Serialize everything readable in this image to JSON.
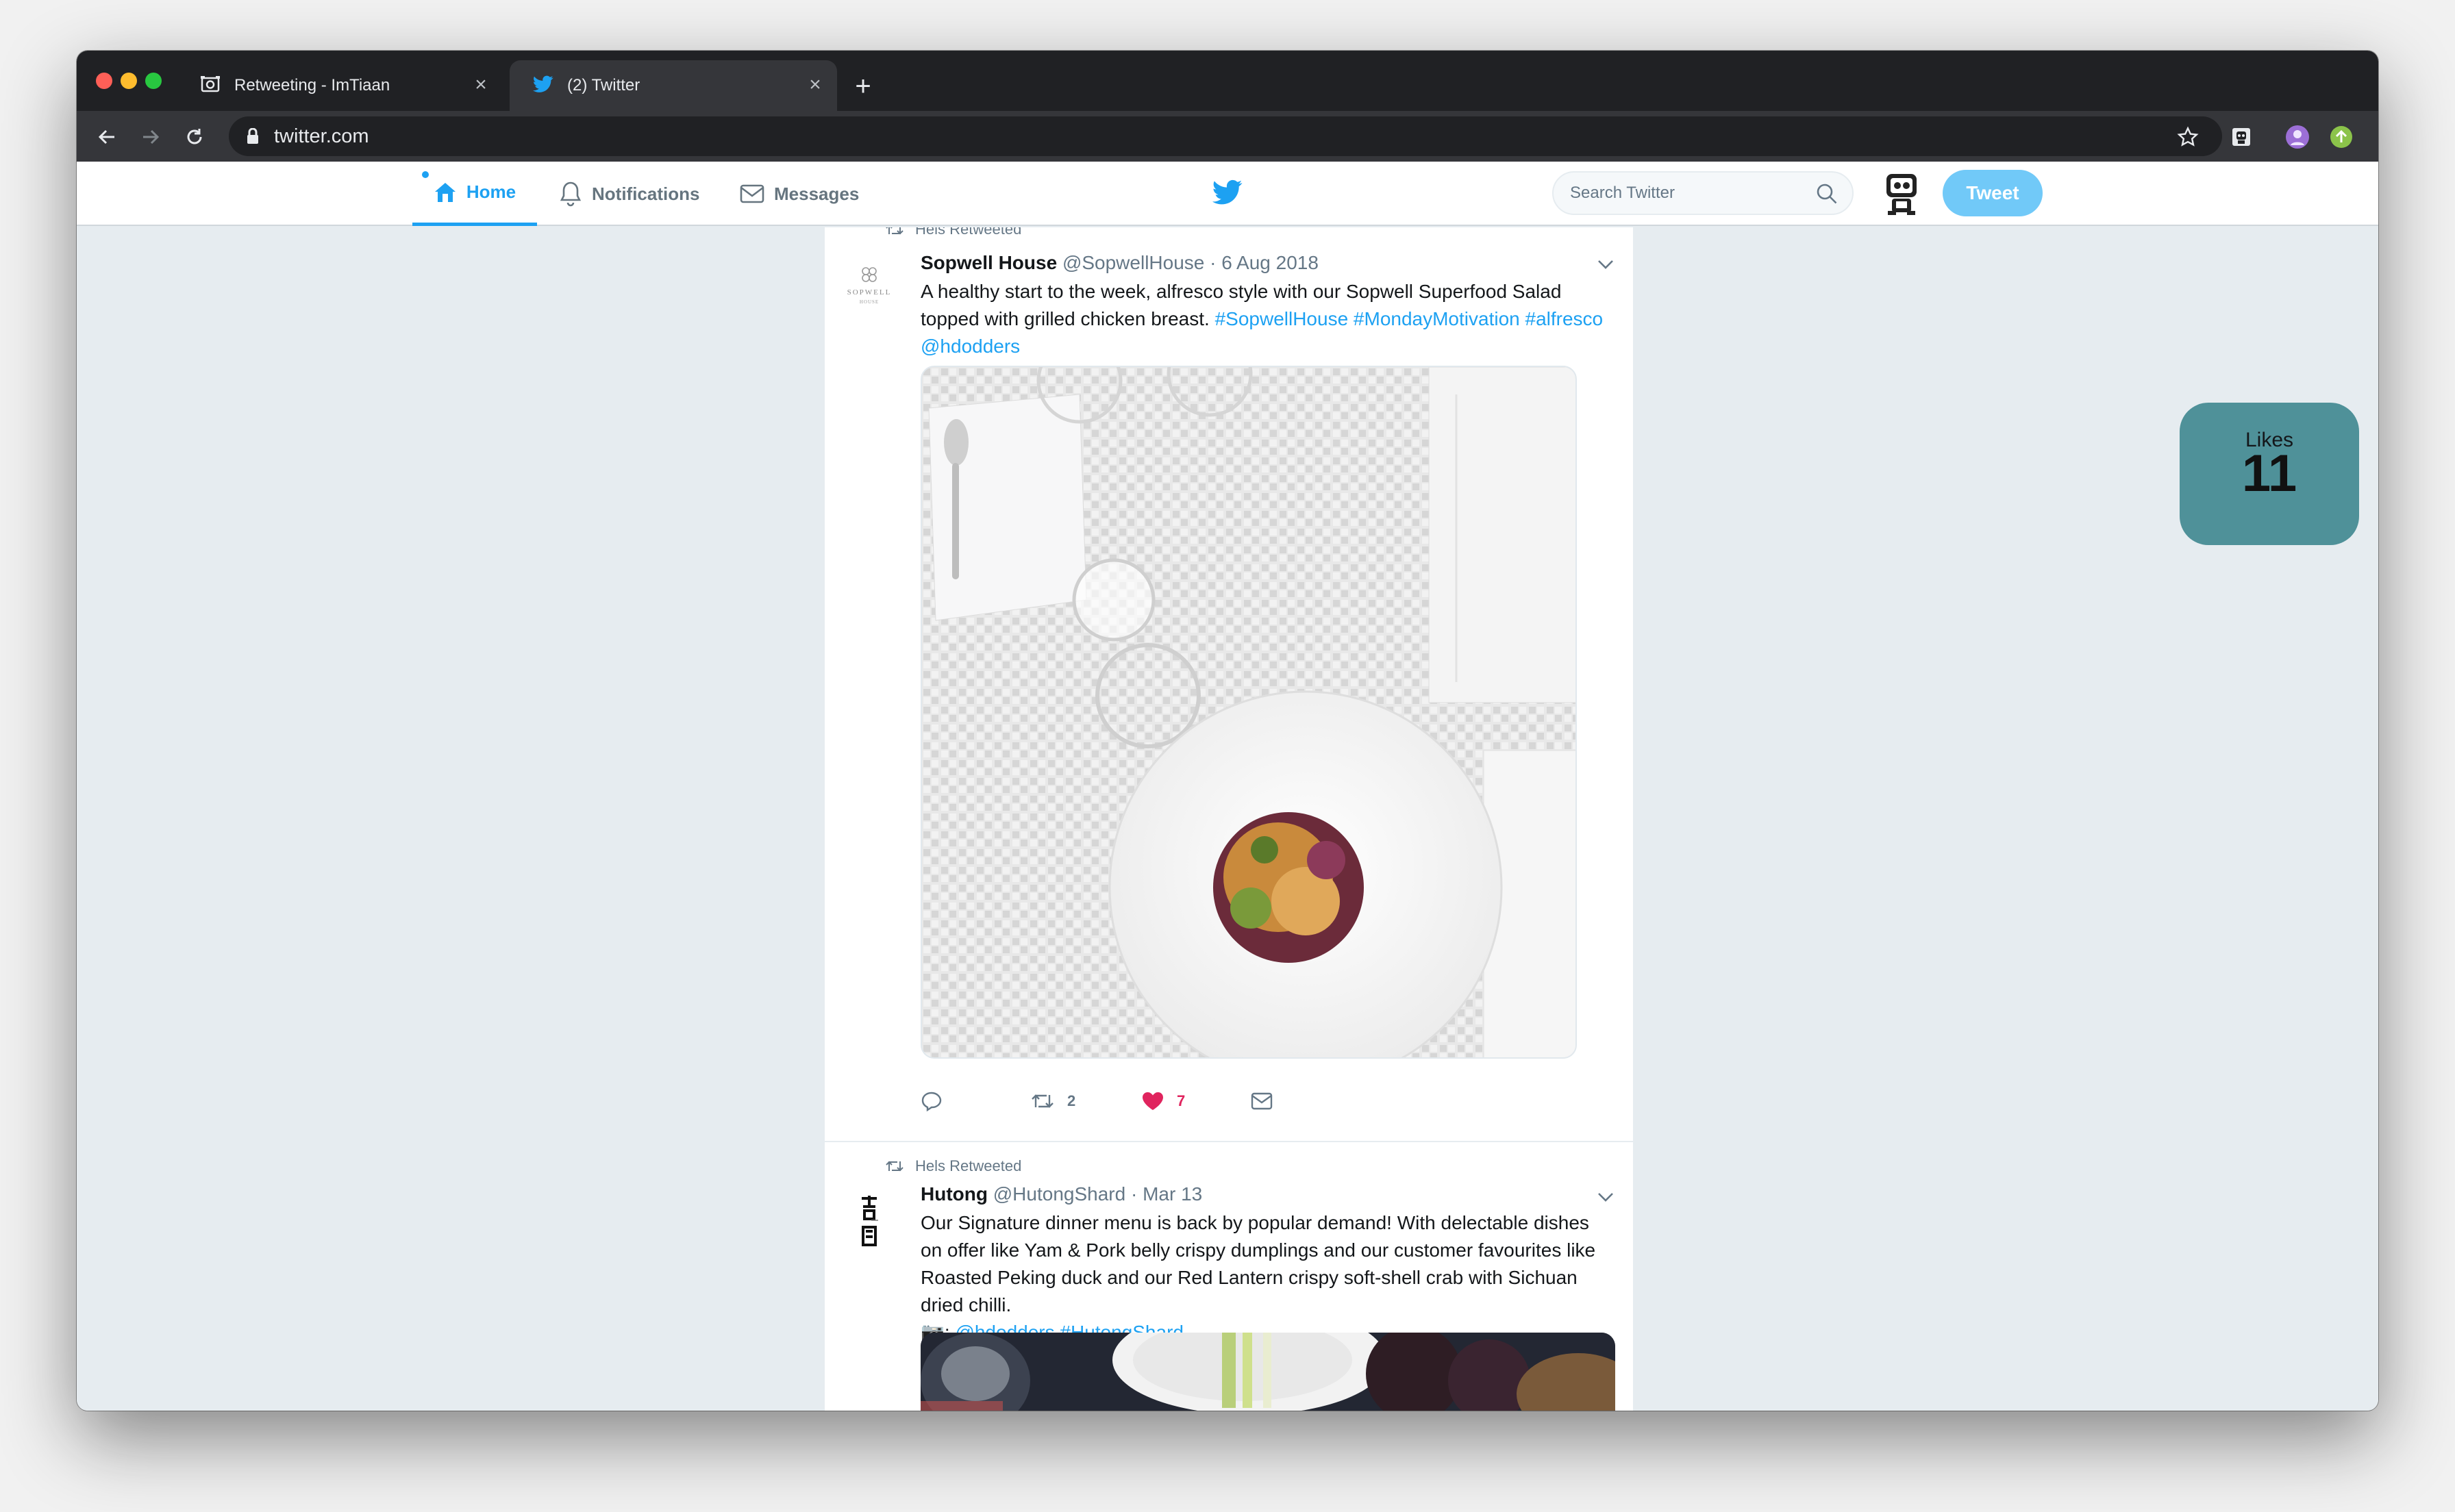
{
  "browser": {
    "tabs": [
      {
        "title": "Retweeting - ImTiaan",
        "icon": "camera-icon"
      },
      {
        "title": "(2) Twitter",
        "icon": "twitter-bird-icon"
      }
    ],
    "new_tab_label": "+",
    "url": "twitter.com"
  },
  "nav": {
    "home": "Home",
    "notifications": "Notifications",
    "messages": "Messages",
    "search_placeholder": "Search Twitter",
    "tweet_button": "Tweet",
    "accent_color": "#1da1f2"
  },
  "tweets": [
    {
      "retweeted_by": "Hels Retweeted",
      "name": "Sopwell House",
      "handle": "@SopwellHouse",
      "date": "· 6 Aug 2018",
      "avatar_text": "SOPWELL",
      "avatar_subtext": "HOUSE",
      "text_plain": "A healthy start to the week, alfresco style with our Sopwell Superfood Salad topped with grilled chicken breast. ",
      "text_links": "#SopwellHouse #MondayMotivation #alfresco @hdodders",
      "retweets": "2",
      "likes": "7",
      "liked": true
    },
    {
      "retweeted_by": "Hels Retweeted",
      "name": "Hutong",
      "handle": "@HutongShard",
      "date": "· Mar 13",
      "text_plain": "Our Signature dinner menu is back by popular demand! With delectable dishes on offer like Yam & Pork belly crispy dumplings and our customer favourites like Roasted Peking duck and our Red Lantern crispy soft-shell crab with Sichuan dried chilli.",
      "camera_prefix": "📷:",
      "text_links": "@hdodders #HutongShard"
    }
  ],
  "likes_badge": {
    "label": "Likes",
    "value": "11",
    "color": "#4f9199"
  }
}
